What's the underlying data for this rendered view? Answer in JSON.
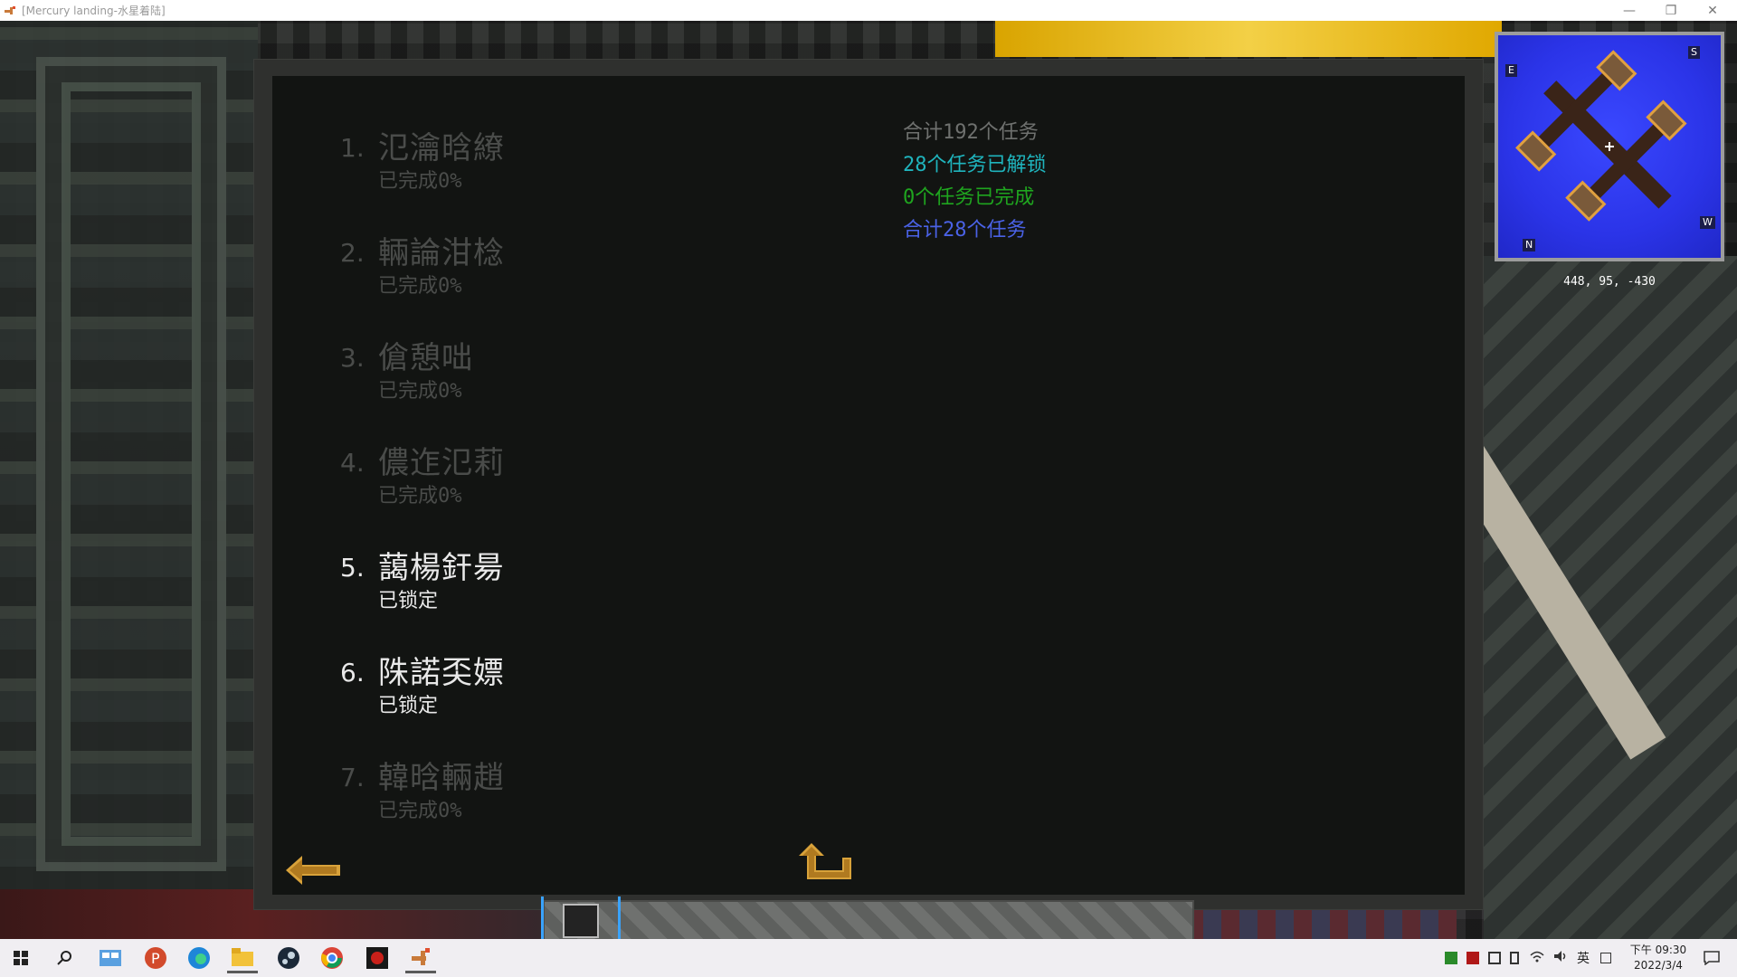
{
  "window": {
    "title": "[Mercury landing-水星着陆]",
    "minimize_glyph": "—",
    "restore_glyph": "❐",
    "close_glyph": "✕"
  },
  "quests": [
    {
      "number": "1.",
      "name": "氾瀹晗繚",
      "status": "已完成0%",
      "state": "dim"
    },
    {
      "number": "2.",
      "name": "輛論泔棯",
      "status": "已完成0%",
      "state": "dim"
    },
    {
      "number": "3.",
      "name": "傖憩咄",
      "status": "已完成0%",
      "state": "dim"
    },
    {
      "number": "4.",
      "name": "儂迮氾莉",
      "status": "已完成0%",
      "state": "dim"
    },
    {
      "number": "5.",
      "name": "藹楊釬昜",
      "status": "已锁定",
      "state": "bright"
    },
    {
      "number": "6.",
      "name": "陎諾奀嫖",
      "status": "已锁定",
      "state": "bright"
    },
    {
      "number": "7.",
      "name": "韓晗輛趙",
      "status": "已完成0%",
      "state": "dim"
    }
  ],
  "summary": {
    "total": "合计192个任务",
    "unlocked": "28个任务已解锁",
    "completed": "0个任务已完成",
    "total_shown": "合计28个任务"
  },
  "minimap": {
    "compass_e": "E",
    "compass_s": "S",
    "compass_w": "W",
    "compass_n": "N",
    "coordinates": "448, 95, -430"
  },
  "taskbar": {
    "ime_label": "英",
    "time": "下午 09:30",
    "date": "2022/3/4",
    "icons": [
      "windows-start-icon",
      "search-icon",
      "task-view-icon",
      "app-p-icon",
      "edge-icon",
      "file-explorer-icon",
      "steam-icon",
      "chrome-icon",
      "red-app-icon",
      "minecraft-launcher-icon"
    ]
  },
  "colors": {
    "summary_total": "#6f716f",
    "summary_unlocked": "#1fb4bd",
    "summary_completed": "#1fa51f",
    "summary_total_shown": "#4a62e6",
    "arrow": "#d8a23a"
  }
}
